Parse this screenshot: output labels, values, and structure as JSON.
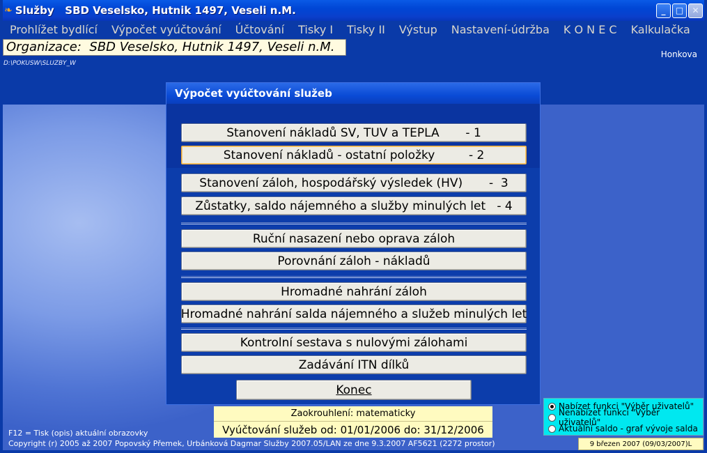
{
  "window": {
    "title": "Služby   SBD Veselsko, Hutnik 1497, Veseli n.M.",
    "icon": "butterfly-icon",
    "controls": {
      "minimize": "_",
      "maximize": "□",
      "close": "✕"
    }
  },
  "menu": [
    {
      "label": "Prohlížet bydlící"
    },
    {
      "label": "Výpočet vyúčtování"
    },
    {
      "label": "Účtování"
    },
    {
      "label": "Tisky I"
    },
    {
      "label": "Tisky II"
    },
    {
      "label": "Výstup"
    },
    {
      "label": "Nastavení-údržba"
    },
    {
      "label": "K O N E C"
    },
    {
      "label": "Kalkulačka"
    }
  ],
  "organization": "Organizace:  SBD Veselsko, Hutnik 1497, Veseli n.M.",
  "user": "Honkova",
  "path": "D:\\POKUSW\\SLUZBY_W",
  "dialog": {
    "title": "Výpočet vyúčtování služeb",
    "buttons": [
      {
        "label": "Stanovení nákladů SV, TUV a TEPLA       - 1"
      },
      {
        "label": "Stanovení nákladů - ostatní položky         - 2"
      },
      {
        "label": "Stanovení záloh, hospodářský výsledek (HV)       -  3"
      },
      {
        "label": "Zůstatky, saldo nájemného a služby minulých let   - 4"
      },
      {
        "label": "Ruční nasazení nebo oprava záloh"
      },
      {
        "label": "Porovnání záloh - nákladů"
      },
      {
        "label": "Hromadné nahrání záloh"
      },
      {
        "label": "Hromadné nahrání salda nájemného a služeb minulých let"
      },
      {
        "label": "Kontrolní sestava s nulovými zálohami"
      },
      {
        "label": "Zadávání ITN dílků"
      }
    ],
    "end_label": "Konec"
  },
  "rounding": "Zaokrouhlení: matematicky",
  "period": "Vyúčtování služeb od: 01/01/2006  do: 31/12/2006",
  "f12_hint": "F12 = Tisk (opis) aktuální obrazovky",
  "copyright": "Copyright (r) 2005 až 2007 Popovský Přemek, Urbánková Dagmar  Služby 2007.05/LAN ze dne 9.3.2007 AF5621 (2272 prostor)",
  "options": [
    {
      "label": "Nabízet funkci \"Výběr uživatelů\"",
      "checked": true
    },
    {
      "label": "Nenabízet funkci \"Výběr uživatelů\"",
      "checked": false
    },
    {
      "label": "Aktuální saldo - graf vývoje salda",
      "checked": false
    }
  ],
  "date": "9 březen 2007 (09/03/2007)L"
}
